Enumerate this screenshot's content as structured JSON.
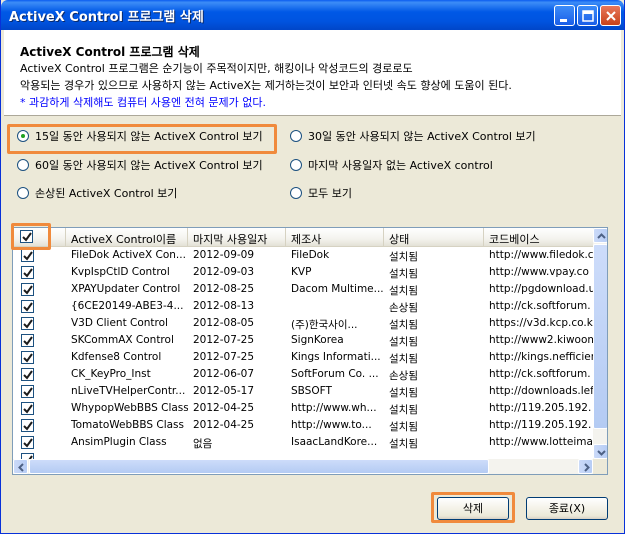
{
  "window": {
    "title": "ActiveX Control 프로그램 삭제"
  },
  "header": {
    "title": "ActiveX Control 프로그램 삭제",
    "line1": "ActiveX Control 프로그램은 순기능이 주목적이지만, 해킹이나 악성코드의 경로로도",
    "line2": "악용되는 경우가 있으므로 사용하지 않는 ActiveX는 제거하는것이 보안과 인터넷 속도 향상에 도움이 된다.",
    "note": "* 과감하게 삭제해도 컴퓨터 사용엔 전혀 문제가 없다."
  },
  "filters": [
    {
      "label": "15일 동안 사용되지 않는 ActiveX Control 보기",
      "selected": true
    },
    {
      "label": "30일 동안 사용되지 않는 ActiveX Control 보기",
      "selected": false
    },
    {
      "label": "60일 동안 사용되지 않는 ActiveX Control 보기",
      "selected": false
    },
    {
      "label": "마지막 사용일자 없는 ActiveX control",
      "selected": false
    },
    {
      "label": "손상된 ActiveX Control 보기",
      "selected": false
    },
    {
      "label": "모두 보기",
      "selected": false
    }
  ],
  "table": {
    "select_all_checked": true,
    "columns": [
      "ActiveX Control이름",
      "마지막 사용일자",
      "제조사",
      "상태",
      "코드베이스"
    ],
    "rows": [
      {
        "checked": true,
        "name": "FileDok ActiveX Con...",
        "date": "2012-09-09",
        "vendor": "FileDok",
        "status": "설치됨",
        "codebase": "http://www.filedok.c"
      },
      {
        "checked": true,
        "name": "KvpIspCtlD Control",
        "date": "2012-09-03",
        "vendor": "KVP",
        "status": "설치됨",
        "codebase": "http://www.vpay.co"
      },
      {
        "checked": true,
        "name": "XPAYUpdater Control",
        "date": "2012-08-25",
        "vendor": "Dacom Multime...",
        "status": "설치됨",
        "codebase": "http://pgdownload.u"
      },
      {
        "checked": true,
        "name": "{6CE20149-ABE3-4...",
        "date": "2012-08-13",
        "vendor": "",
        "status": "손상됨",
        "codebase": "http://ck.softforum."
      },
      {
        "checked": true,
        "name": "V3D Client Control",
        "date": "2012-08-05",
        "vendor": "(주)한국사이...",
        "status": "설치됨",
        "codebase": "https://v3d.kcp.co.k"
      },
      {
        "checked": true,
        "name": "SKCommAX Control",
        "date": "2012-07-25",
        "vendor": "SignKorea",
        "status": "설치됨",
        "codebase": "http://www2.kiwoom"
      },
      {
        "checked": true,
        "name": "Kdfense8 Control",
        "date": "2012-07-25",
        "vendor": "Kings Informati...",
        "status": "설치됨",
        "codebase": "http://kings.nefficier"
      },
      {
        "checked": true,
        "name": "CK_KeyPro_Inst",
        "date": "2012-06-07",
        "vendor": "SoftForum Co. ...",
        "status": "손상됨",
        "codebase": "http://ck.softforum."
      },
      {
        "checked": true,
        "name": "nLiveTVHelperContr...",
        "date": "2012-05-17",
        "vendor": "SBSOFT",
        "status": "설치됨",
        "codebase": "http://downloads.lef"
      },
      {
        "checked": true,
        "name": "WhypopWebBBS Class",
        "date": "2012-04-25",
        "vendor": "http://www.wh...",
        "status": "설치됨",
        "codebase": "http://119.205.192."
      },
      {
        "checked": true,
        "name": "TomatoWebBBS Class",
        "date": "2012-04-25",
        "vendor": "http://www.to...",
        "status": "설치됨",
        "codebase": "http://119.205.192."
      },
      {
        "checked": true,
        "name": "AnsimPlugin Class",
        "date": "없음",
        "vendor": "IsaacLandKore...",
        "status": "설치됨",
        "codebase": "http://www.lotteima"
      },
      {
        "checked": true,
        "name": "",
        "date": "",
        "vendor": "",
        "status": "",
        "codebase": ""
      }
    ]
  },
  "buttons": {
    "delete": "삭제",
    "close": "종료(X)"
  },
  "colors": {
    "highlight": "#f08a3c",
    "titlebar": "#0054e0",
    "note_text": "#0000ff"
  }
}
